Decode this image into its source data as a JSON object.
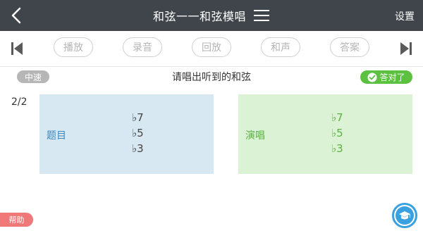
{
  "header": {
    "title": "和弦一一和弦模唱",
    "settings_label": "设置"
  },
  "toolbar": {
    "buttons": [
      "播放",
      "录音",
      "回放",
      "和声",
      "答案"
    ]
  },
  "prompt": {
    "speed": "中速",
    "instruction": "请唱出听到的和弦",
    "result": "答对了"
  },
  "progress": "2/2",
  "question_panel": {
    "label": "题目",
    "notes": [
      "♭7",
      "♭5",
      "♭3"
    ]
  },
  "sing_panel": {
    "label": "演唱",
    "notes": [
      "♭7",
      "♭5",
      "♭3"
    ]
  },
  "help_label": "帮助",
  "colors": {
    "header_bg": "#3f454a",
    "question_bg": "#d8e8f2",
    "sing_bg": "#dcf2d5",
    "correct_green": "#5cc140",
    "help_red": "#f07878",
    "tutor_blue": "#39a1e0"
  },
  "icons": {
    "back": "back-chevron-icon",
    "menu": "menu-icon",
    "prev": "skip-previous-icon",
    "next": "skip-next-icon",
    "check": "check-icon",
    "tutor": "graduation-cap-icon"
  }
}
